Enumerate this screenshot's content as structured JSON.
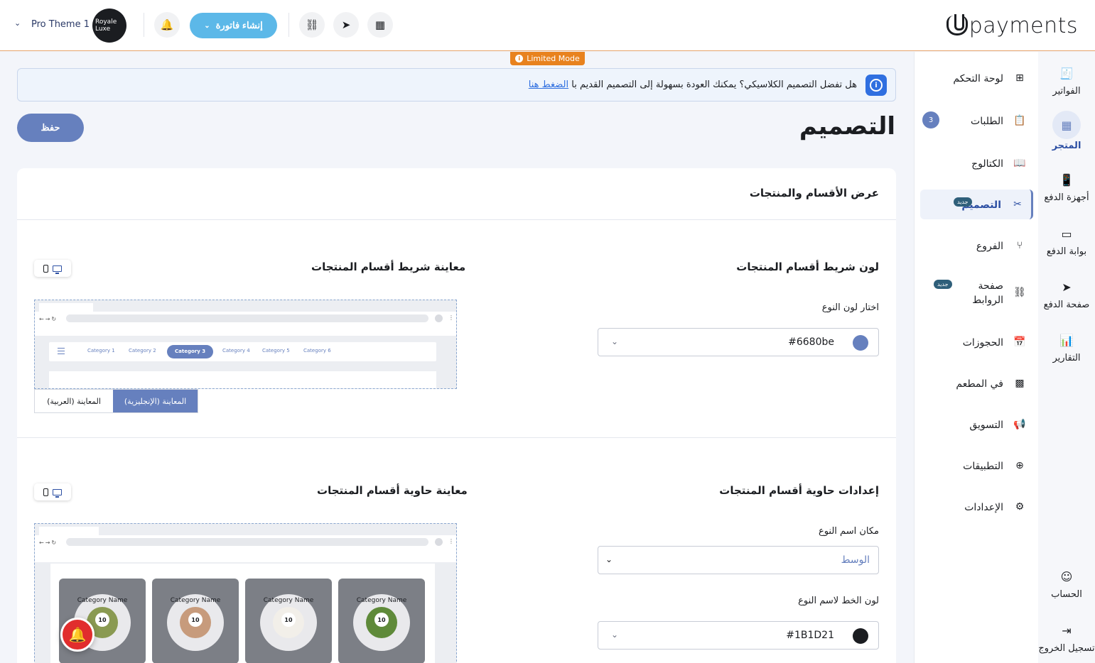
{
  "header": {
    "logo_text": "payments",
    "invoice_button": "إنشاء فاتورة",
    "theme_name": "Pro Theme 1",
    "avatar_text": "Royale Luxe"
  },
  "limited_mode": "Limited Mode",
  "banner": {
    "text": "هل تفضل التصميم الكلاسيكي؟ يمكنك العودة بسهولة إلى التصميم القديم با",
    "link": "الضغط هنا"
  },
  "page": {
    "title": "التصميم",
    "save_label": "حفظ"
  },
  "card": {
    "title": "عرض الأقسام والمنتجات",
    "section1": {
      "settings_title": "لون شريط أقسام المنتجات",
      "color_label": "اختار لون النوع",
      "color_value": "#6680be",
      "preview_title": "معاينة شريط أقسام المنتجات",
      "categories": [
        "Category 1",
        "Category 2",
        "Category 3",
        "Category 4",
        "Category 5",
        "Category 6"
      ],
      "active_category": "Category 3",
      "preview_en": "المعاينة (الإنجليزية)",
      "preview_ar": "المعاينة (العربية)"
    },
    "section2": {
      "settings_title": "إعدادات حاوية أقسام المنتجات",
      "position_label": "مكان اسم النوع",
      "position_value": "الوسط",
      "font_color_label": "لون الخط لاسم النوع",
      "font_color_value": "#1B1D21",
      "preview_title": "معاينة حاوية أقسام المنتجات",
      "category_cards": [
        {
          "name": "Category Name",
          "count": "10"
        },
        {
          "name": "Category Name",
          "count": "10"
        },
        {
          "name": "Category Name",
          "count": "10"
        },
        {
          "name": "Category Name",
          "count": "10"
        }
      ]
    }
  },
  "sidebar": {
    "items": [
      {
        "label": "لوحة التحكم",
        "icon": "grid-icon"
      },
      {
        "label": "الطلبات",
        "icon": "clipboard-icon",
        "count": "3"
      },
      {
        "label": "الكتالوج",
        "icon": "book-icon"
      },
      {
        "label": "التصميم",
        "icon": "design-tools-icon",
        "badge": "جديد",
        "active": true
      },
      {
        "label": "الفروع",
        "icon": "branch-icon"
      },
      {
        "label": "صفحة الروابط",
        "icon": "link-icon",
        "badge": "جديد"
      },
      {
        "label": "الحجوزات",
        "icon": "calendar-icon"
      },
      {
        "label": "في المطعم",
        "icon": "qr-icon"
      },
      {
        "label": "التسويق",
        "icon": "megaphone-icon"
      },
      {
        "label": "التطبيقات",
        "icon": "apps-icon"
      },
      {
        "label": "الإعدادات",
        "icon": "gear-icon"
      }
    ]
  },
  "rail": {
    "items": [
      {
        "label": "الفواتير",
        "icon": "invoice-icon"
      },
      {
        "label": "المتجر",
        "icon": "store-icon",
        "active": true
      },
      {
        "label": "أجهزة الدفع",
        "icon": "pos-device-icon"
      },
      {
        "label": "بوابة الدفع",
        "icon": "gateway-icon"
      },
      {
        "label": "صفحة الدفع",
        "icon": "send-icon"
      },
      {
        "label": "التقارير",
        "icon": "chart-icon"
      },
      {
        "label": "الحساب",
        "icon": "account-icon"
      },
      {
        "label": "تسجيل الخروج",
        "icon": "logout-icon"
      }
    ]
  },
  "colors": {
    "accent": "#6680be",
    "invoice_button": "#5cb8e8",
    "limited_badge": "#e8821e",
    "font_color_swatch": "#1b1d21"
  }
}
